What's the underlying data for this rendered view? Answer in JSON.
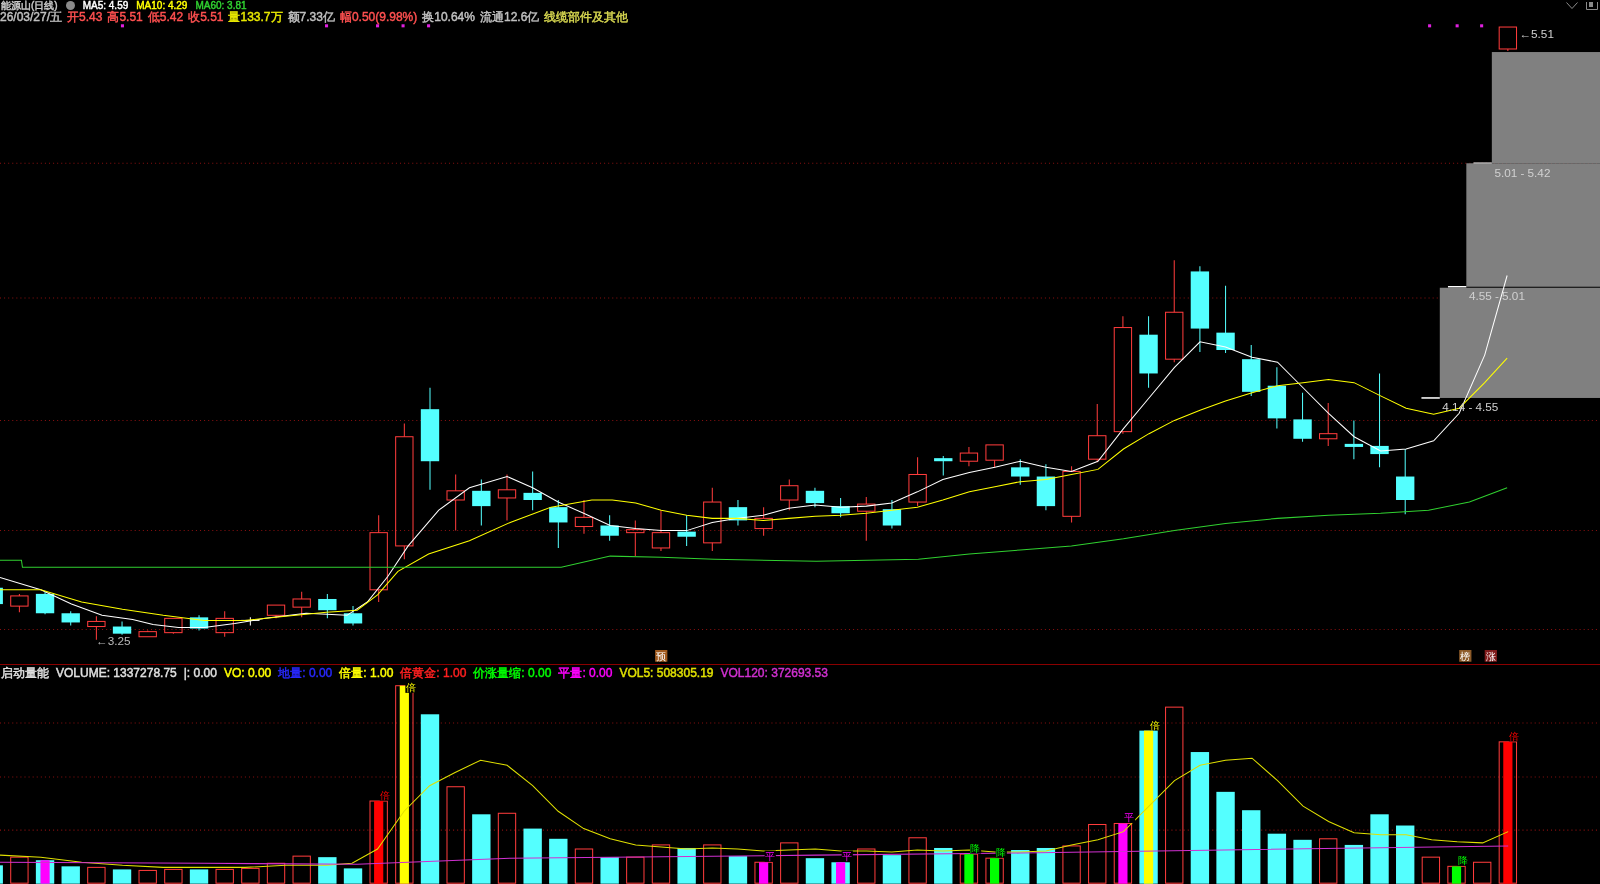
{
  "title_bar": {
    "stock": "能源山(日线)",
    "moving_averages": [
      {
        "text": "MA5: 4.59",
        "color": "#ffffff"
      },
      {
        "text": "MA10: 4.29",
        "color": "#ffff00"
      },
      {
        "text": "MA60: 3.81",
        "color": "#30d030"
      }
    ]
  },
  "quote": [
    {
      "text": "26/03/27/五",
      "color": "#c0c0c0"
    },
    {
      "text": "开5.43",
      "color": "#ff5050"
    },
    {
      "text": "高5.51",
      "color": "#ff5050"
    },
    {
      "text": "低5.42",
      "color": "#ff5050"
    },
    {
      "text": "收5.51",
      "color": "#ff5050"
    },
    {
      "text": "量133.7万",
      "color": "#e8e800"
    },
    {
      "text": "额7.33亿",
      "color": "#c0c0c0"
    },
    {
      "text": "幅0.50(9.98%)",
      "color": "#ff5050"
    },
    {
      "text": "换10.64%",
      "color": "#c0c0c0"
    },
    {
      "text": "流通12.6亿",
      "color": "#c0c0c0"
    },
    {
      "text": "线缆部件及其他",
      "color": "#d8d850"
    }
  ],
  "price_chart": {
    "low_label": "←3.25",
    "high_label": "←5.51",
    "price_zones": [
      {
        "label": "5.01 - 5.42"
      },
      {
        "label": "4.55 - 5.01"
      },
      {
        "label": "4.14 - 4.55"
      }
    ],
    "badges": [
      {
        "label": "预",
        "color": "#a05a1e"
      },
      {
        "label": "榜",
        "color": "#8c5a28"
      },
      {
        "label": "涨",
        "color": "#801c1c"
      }
    ]
  },
  "volume_panel": {
    "name": "启动量能",
    "values": [
      {
        "text": "VOLUME: 1337278.75",
        "color": "#e0e0e0"
      },
      {
        "text": "|: 0.00",
        "color": "#e0e0e0"
      },
      {
        "text": "VO: 0.00",
        "color": "#ffff00"
      },
      {
        "text": "地量: 0.00",
        "color": "#2828ff"
      },
      {
        "text": "倍量: 1.00",
        "color": "#ffff00"
      },
      {
        "text": "倍黄金: 1.00",
        "color": "#ff2020"
      },
      {
        "text": "价涨量缩: 0.00",
        "color": "#00ff00"
      },
      {
        "text": "平量: 0.00",
        "color": "#ff00ff"
      },
      {
        "text": "VOL5: 508305.19",
        "color": "#e0e000"
      },
      {
        "text": "VOL120: 372693.53",
        "color": "#d030d0"
      }
    ],
    "signals": [
      {
        "label": "倍",
        "color": "#ff0000"
      },
      {
        "label": "倍",
        "color": "#ffff00"
      },
      {
        "label": "平",
        "color": "#ff00ff"
      },
      {
        "label": "平",
        "color": "#ff00ff"
      },
      {
        "label": "降",
        "color": "#00ff00"
      },
      {
        "label": "降",
        "color": "#00ff00"
      },
      {
        "label": "平",
        "color": "#ff00ff"
      },
      {
        "label": "倍",
        "color": "#ffff00"
      },
      {
        "label": "降",
        "color": "#00ff00"
      },
      {
        "label": "倍",
        "color": "#ff0000"
      }
    ]
  }
}
